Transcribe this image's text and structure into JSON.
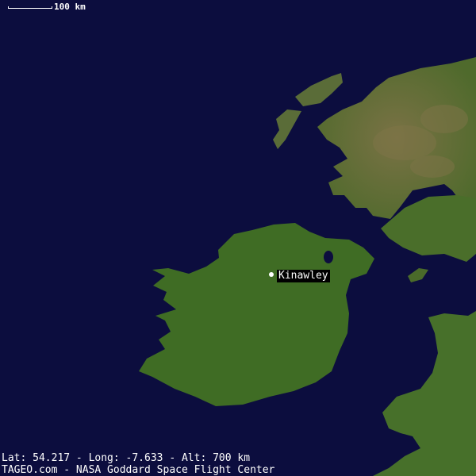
{
  "scale": {
    "label": "100 km"
  },
  "marker": {
    "label": "Kinawley",
    "icon": "location-dot-icon"
  },
  "footer": {
    "coords": "Lat: 54.217 - Long: -7.633 - Alt: 700 km",
    "credits": "TAGEO.com -  NASA Goddard Space Flight Center"
  },
  "colors": {
    "sea": "#0c0d3e",
    "land": "#3d6a22",
    "highland": "#6e6a3c",
    "text": "#ffffff"
  }
}
